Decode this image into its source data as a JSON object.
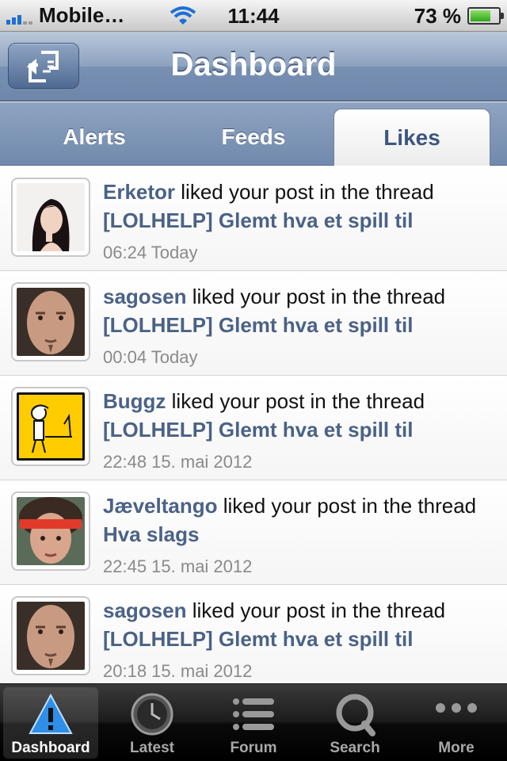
{
  "status_bar": {
    "carrier": "Mobile…",
    "time": "11:44",
    "battery_percent": "73 %",
    "battery_level": 0.73
  },
  "nav": {
    "title": "Dashboard",
    "back_icon": "rotate-arrow-icon"
  },
  "tabs": [
    {
      "label": "Alerts",
      "active": false
    },
    {
      "label": "Feeds",
      "active": false
    },
    {
      "label": "Likes",
      "active": true
    }
  ],
  "items": [
    {
      "user": "Erketor",
      "action": " liked your post in the thread",
      "thread": "[LOLHELP] Glemt hva et spill til",
      "time": "06:24 Today"
    },
    {
      "user": "sagosen",
      "action": " liked your post in the thread",
      "thread": "[LOLHELP] Glemt hva et spill til",
      "time": "00:04 Today"
    },
    {
      "user": "Buggz",
      "action": " liked your post in the thread",
      "thread": "[LOLHELP] Glemt hva et spill til",
      "time": "22:48 15. mai 2012"
    },
    {
      "user": "Jæveltango",
      "action": " liked your post in the thread",
      "thread": "Hva slags",
      "time": "22:45 15. mai 2012"
    },
    {
      "user": "sagosen",
      "action": " liked your post in the thread",
      "thread": "[LOLHELP] Glemt hva et spill til",
      "time": "20:18 15. mai 2012"
    }
  ],
  "tabbar": [
    {
      "label": "Dashboard",
      "icon": "warning-icon",
      "active": true
    },
    {
      "label": "Latest",
      "icon": "clock-icon",
      "active": false
    },
    {
      "label": "Forum",
      "icon": "list-icon",
      "active": false
    },
    {
      "label": "Search",
      "icon": "search-icon",
      "active": false
    },
    {
      "label": "More",
      "icon": "more-dots-icon",
      "active": false
    }
  ],
  "colors": {
    "link": "#4b6286",
    "timestamp": "#8a8a8a",
    "navbar": "#7890b2"
  }
}
